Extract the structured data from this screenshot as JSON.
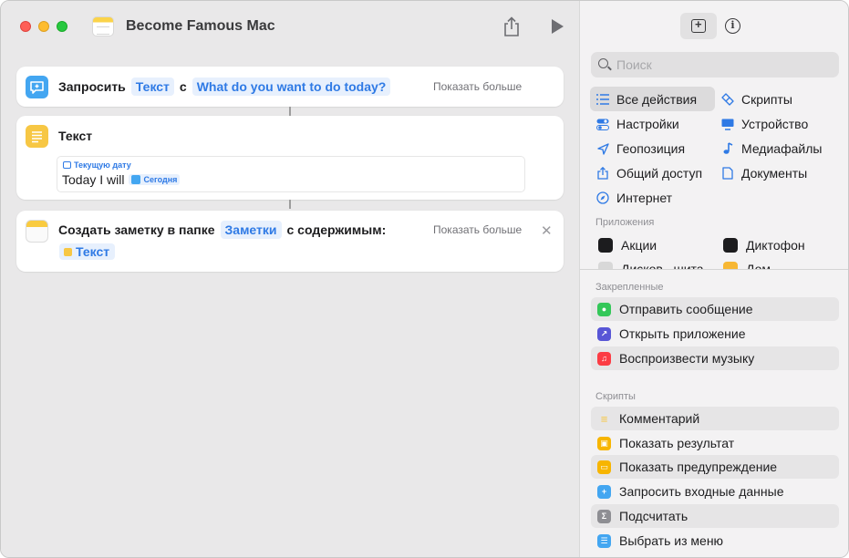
{
  "window": {
    "title": "Become Famous Mac"
  },
  "actions": [
    {
      "verb": "Запросить",
      "token1": "Текст",
      "connector": "с",
      "prompt": "What do you want to do today?",
      "more": "Показать больше"
    },
    {
      "title": "Текст",
      "variable_label": "Текущую дату",
      "body_text": "Today I will",
      "inline_token": "Сегодня"
    },
    {
      "verb": "Создать заметку в папке",
      "folder": "Заметки",
      "suffix": "с содержимым:",
      "more": "Показать больше",
      "content_token": "Текст"
    }
  ],
  "sidebar": {
    "search_placeholder": "Поиск",
    "categories": [
      {
        "label": "Все действия",
        "icon": "list-icon",
        "selected": true
      },
      {
        "label": "Скрипты",
        "icon": "scripts-icon"
      },
      {
        "label": "Настройки",
        "icon": "toggle-icon"
      },
      {
        "label": "Устройство",
        "icon": "display-icon"
      },
      {
        "label": "Геопозиция",
        "icon": "location-icon"
      },
      {
        "label": "Медиафайлы",
        "icon": "music-note-icon"
      },
      {
        "label": "Общий доступ",
        "icon": "share-icon"
      },
      {
        "label": "Документы",
        "icon": "document-icon"
      },
      {
        "label": "Интернет",
        "icon": "compass-icon"
      }
    ],
    "apps_header": "Приложения",
    "apps": [
      {
        "label": "Акции",
        "color": "#1c1c1e"
      },
      {
        "label": "Диктофон",
        "color": "#1c1c1e"
      },
      {
        "label": "Дисков...шита",
        "color": "#d8d8d8"
      },
      {
        "label": "Дом",
        "color": "#f7b733"
      }
    ],
    "pinned_header": "Закрепленные",
    "pinned": [
      {
        "label": "Отправить сообщение",
        "color": "#34c759"
      },
      {
        "label": "Открыть приложение",
        "color": "#5856d6"
      },
      {
        "label": "Воспроизвести музыку",
        "color": "#fc3c44"
      }
    ],
    "scripts_header": "Скрипты",
    "scripts": [
      {
        "label": "Комментарий",
        "color": "#f7c744"
      },
      {
        "label": "Показать результат",
        "color": "#f7b500"
      },
      {
        "label": "Показать предупреждение",
        "color": "#f7b500"
      },
      {
        "label": "Запросить входные данные",
        "color": "#43a6f1"
      },
      {
        "label": "Подсчитать",
        "color": "#8e8e93"
      },
      {
        "label": "Выбрать из меню",
        "color": "#43a6f1"
      }
    ]
  },
  "colors": {
    "accent": "#2f7ae5",
    "token_bg": "#e7f0fd"
  }
}
